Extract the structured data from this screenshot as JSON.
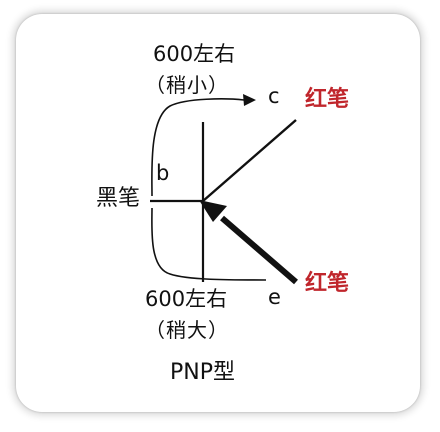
{
  "diagram": {
    "top_reading": "600左右",
    "top_note": "（稍小）",
    "bottom_reading": "600左右",
    "bottom_note": "（稍大）",
    "pin_c": "c",
    "pin_b": "b",
    "pin_e": "e",
    "black_probe": "黑笔",
    "red_probe_top": "红笔",
    "red_probe_bottom": "红笔",
    "transistor_type": "PNP型",
    "colors": {
      "line": "#111111",
      "red_text": "#c0262c"
    }
  }
}
